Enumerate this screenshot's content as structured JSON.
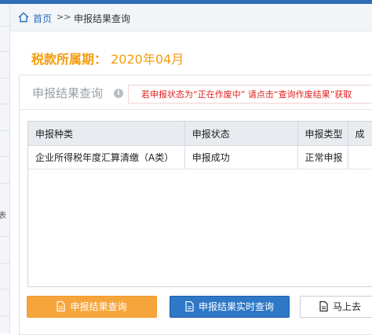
{
  "breadcrumb": {
    "home": "首页",
    "separator": ">>",
    "current": "申报结果查询"
  },
  "period": {
    "label": "税款所属期：",
    "value": "2020年04月"
  },
  "panel": {
    "title": "申报结果查询",
    "notice": "若申报状态为“正在作废中”  请点击“查询作废结果”获取"
  },
  "table": {
    "headers": [
      "申报种类",
      "申报状态",
      "申报类型",
      "成"
    ],
    "rows": [
      [
        "企业所得税年度汇算清缴（A类）",
        "申报成功",
        "正常申报",
        ""
      ]
    ]
  },
  "buttons": {
    "query": "申报结果查询",
    "realtime": "申报结果实时查询",
    "goto": "马上去"
  },
  "sidebar": {
    "fragment": "表"
  },
  "colors": {
    "accent": "#f39c12",
    "primary": "#2f78c7",
    "notice": "#e02020"
  }
}
